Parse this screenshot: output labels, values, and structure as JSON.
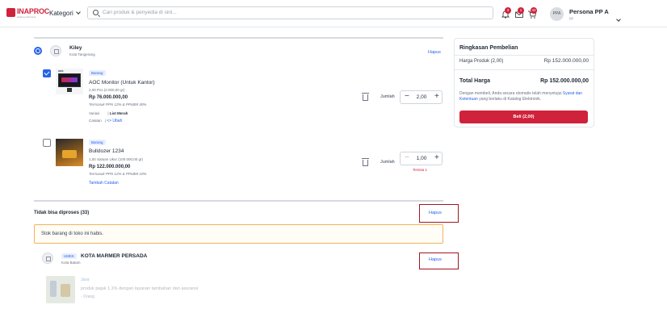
{
  "header": {
    "logo_text": "INAPROC",
    "logo_sub": "katalog elektronik",
    "kategori_label": "Kategori",
    "search_placeholder": "Cari produk & penyedia di sini...",
    "badges": {
      "notification": "3",
      "mail": "1",
      "cart": "42"
    },
    "avatar_initials": "PPA",
    "user_name": "Persona PP A",
    "user_role": "pp"
  },
  "cart": {
    "store": {
      "name": "Kiley",
      "city": "Kota Tangerang",
      "hapus": "Hapus"
    },
    "items": [
      {
        "tag": "Barang",
        "name": "AOC Monitor (Untuk Kantor)",
        "qty_info": "2,00 Pcs (2.000,00 gr)",
        "price": "Rp 76.000.000,00",
        "tax": "Termasuk PPN 12% & PPnBM 40%",
        "variasi_label": "Variasi",
        "variasi_value": "List Merah",
        "catatan_label": "Catatan",
        "catatan_link": "<> Ubah",
        "jumlah_label": "Jumlah",
        "quantity": "2,00",
        "checked": true
      },
      {
        "tag": "Barang",
        "name": "Bulldozer 1234",
        "qty_info": "1,00 Satuan Ukur (100.000,00 gr)",
        "price": "Rp 122.000.000,00",
        "tax": "Termasuk PPN 12% & PPnBM 10%",
        "catatan_link": "Tambah Catatan",
        "jumlah_label": "Jumlah",
        "quantity": "1,00",
        "stock_note": "Tersisa 1",
        "checked": false
      }
    ]
  },
  "unprocessable": {
    "title": "Tidak bisa diproses (33)",
    "hapus": "Hapus",
    "warning": "Stok barang di toko ini habis.",
    "store": {
      "badge": "UMKK",
      "name": "KOTA MARMER PERSADA",
      "city": "Kota Batam",
      "hapus": "Hapus"
    },
    "item": {
      "tag": "Jasa",
      "name": "produk pajak 1,1% dengan layanan tambahan dan asuransi",
      "qty": "- Orang"
    }
  },
  "summary": {
    "title": "Ringkasan Pembelian",
    "harga_label": "Harga Produk (2,00)",
    "harga_value": "Rp 152.000.000,00",
    "total_label": "Total Harga",
    "total_value": "Rp 152.000.000,00",
    "note_pre": "Dengan membeli, Anda secara otomatis telah menyetujui",
    "note_link": "Syarat dan Ketentuan",
    "note_post": "yang berlaku di Katalog Elektronik.",
    "buy_label": "Beli (2,00)"
  },
  "colors": {
    "brand": "#d0223b",
    "link": "#2563eb",
    "warning_border": "#f2b35b"
  }
}
